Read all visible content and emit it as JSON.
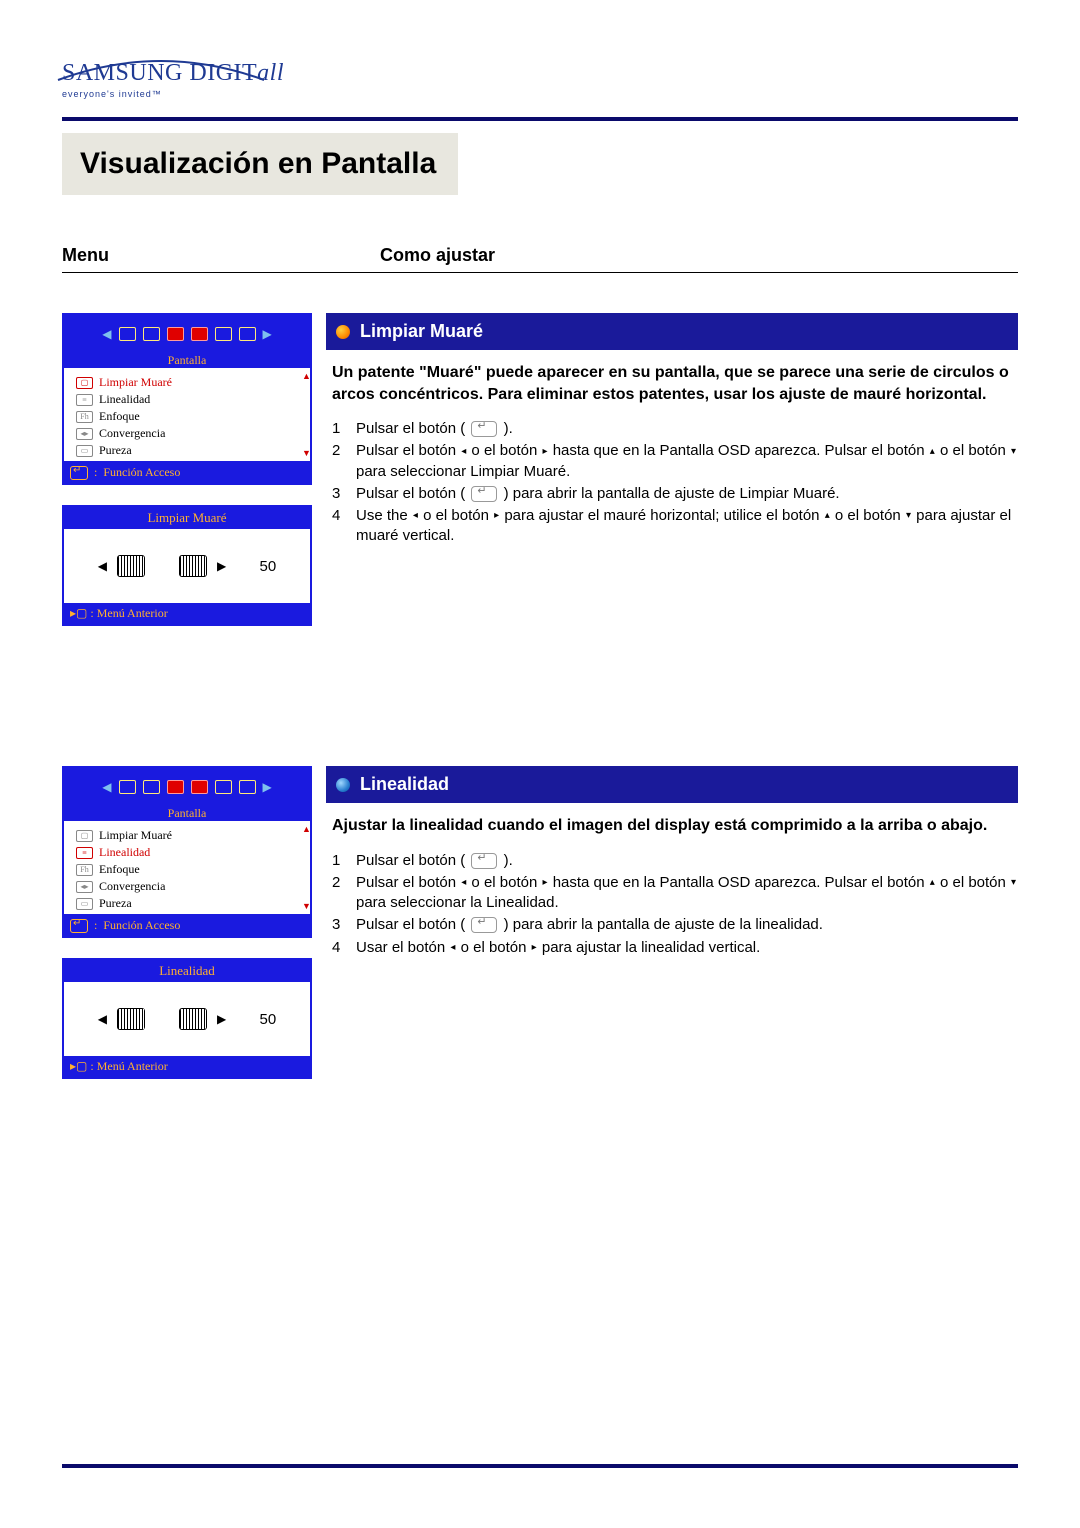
{
  "brand": {
    "text_a": "SAMSUNG DIGIT",
    "text_b": "all",
    "tagline": "everyone's invited™"
  },
  "page_title": "Visualización en Pantalla",
  "columns": {
    "menu": "Menu",
    "como": "Como ajustar"
  },
  "osd": {
    "tab_label": "Pantalla",
    "function": "Función Acceso",
    "prev_menu": "Menú Anterior",
    "items": [
      {
        "label": "Limpiar Muaré"
      },
      {
        "label": "Linealidad"
      },
      {
        "label": "Enfoque"
      },
      {
        "label": "Convergencia"
      },
      {
        "label": "Pureza"
      }
    ]
  },
  "sections": [
    {
      "title": "Limpiar Muaré",
      "selected_index": 0,
      "adjust_title": "Limpiar Muaré",
      "adjust_value": "50",
      "desc": "Un patente \"Muaré\" puede aparecer en su pantalla, que se parece una serie de circulos o arcos concéntricos. Para eliminar estos patentes, usar los ajuste de mauré horizontal.",
      "steps": [
        {
          "n": "1",
          "t": "Pulsar el botón ( [ENTER] )."
        },
        {
          "n": "2",
          "t": "Pulsar el botón ◂  o el botón ▸  hasta que en la Pantalla OSD aparezca. Pulsar el botón ▴  o el botón ▾  para seleccionar Limpiar Muaré."
        },
        {
          "n": "3",
          "t": "Pulsar el botón ( [ENTER] ) para abrir la pantalla de ajuste de Limpiar Muaré."
        },
        {
          "n": "4",
          "t": "Use the ◂  o el botón ▸  para ajustar el mauré horizontal; utilice el botón ▴  o el botón ▾  para ajustar el muaré vertical."
        }
      ],
      "dot": "orange"
    },
    {
      "title": "Linealidad",
      "selected_index": 1,
      "adjust_title": "Linealidad",
      "adjust_value": "50",
      "desc": "Ajustar la linealidad cuando el imagen del display está comprimido a la arriba o abajo.",
      "steps": [
        {
          "n": "1",
          "t": "Pulsar el botón ( [ENTER] )."
        },
        {
          "n": "2",
          "t": "Pulsar el botón ◂  o el botón ▸  hasta que en la Pantalla OSD aparezca. Pulsar el botón ▴  o el botón ▾  para seleccionar la Linealidad."
        },
        {
          "n": "3",
          "t": "Pulsar el botón ( [ENTER] ) para abrir la pantalla de ajuste de la linealidad."
        },
        {
          "n": "4",
          "t": "Usar el botón ◂  o el botón ▸  para ajustar la linealidad vertical."
        }
      ],
      "dot": "blue"
    }
  ]
}
